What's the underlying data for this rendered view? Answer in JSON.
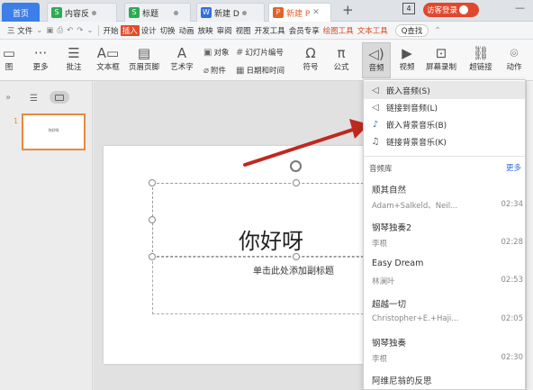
{
  "tabs": [
    {
      "label": "首页",
      "kind": "home"
    },
    {
      "label": "内容反",
      "icon": "S",
      "color": "#2eaa54"
    },
    {
      "label": "标题",
      "icon": "S",
      "color": "#2eaa54"
    },
    {
      "label": "新建 D",
      "icon": "W",
      "color": "#2f6fe0"
    },
    {
      "label": "新建 P",
      "icon": "P",
      "color": "#e5612a"
    }
  ],
  "titlebar": {
    "plus": "+",
    "badge": "4",
    "login": "访客登录",
    "minimize": "—"
  },
  "menu": {
    "file": "三 文件",
    "items": [
      "开始",
      "插入",
      "设计",
      "切换",
      "动画",
      "放映",
      "审阅",
      "视图",
      "开发工具",
      "会员专享",
      "绘图工具",
      "文本工具"
    ],
    "active": "插入",
    "search": "Q查找"
  },
  "ribbon": {
    "more": "更多",
    "comment": "批注",
    "textbox": "文本框",
    "header_footer": "页眉页脚",
    "wordart": "艺术字",
    "object": "对象",
    "slide_number": "幻灯片编号",
    "attachment": "附件",
    "datetime": "日期和时间",
    "symbol": "符号",
    "formula": "公式",
    "audio": "音频",
    "video": "视频",
    "screen_record": "屏幕录制",
    "hyperlink": "超链接",
    "action": "动作",
    "cut_left": "图"
  },
  "slide": {
    "title": "你好呀",
    "subtitle": "单击此处添加副标题",
    "thumb_number": "1",
    "thumb_text": "你好呀"
  },
  "dropdown": {
    "items": [
      "嵌入音频(S)",
      "链接到音频(L)",
      "嵌入背景音乐(B)",
      "链接背景音乐(K)"
    ],
    "library_label": "音频库",
    "more": "更多",
    "songs": [
      {
        "title": "顺其自然",
        "artist": "Adam+Salkeld、Neil...",
        "duration": "02:34"
      },
      {
        "title": "钢琴独奏2",
        "artist": "李根",
        "duration": "02:28"
      },
      {
        "title": "Easy Dream",
        "artist": "林澜叶",
        "duration": "02:53"
      },
      {
        "title": "超越一切",
        "artist": "Christopher+E.+Haji...",
        "duration": "02:05"
      },
      {
        "title": "钢琴独奏",
        "artist": "李根",
        "duration": "02:30"
      },
      {
        "title": "阿维尼翁的反思",
        "artist": "",
        "duration": ""
      }
    ]
  },
  "colors": {
    "accent": "#e04c2b",
    "home_tab": "#3d7ee8",
    "arrow": "#c0291f",
    "login": "#e0482d"
  }
}
